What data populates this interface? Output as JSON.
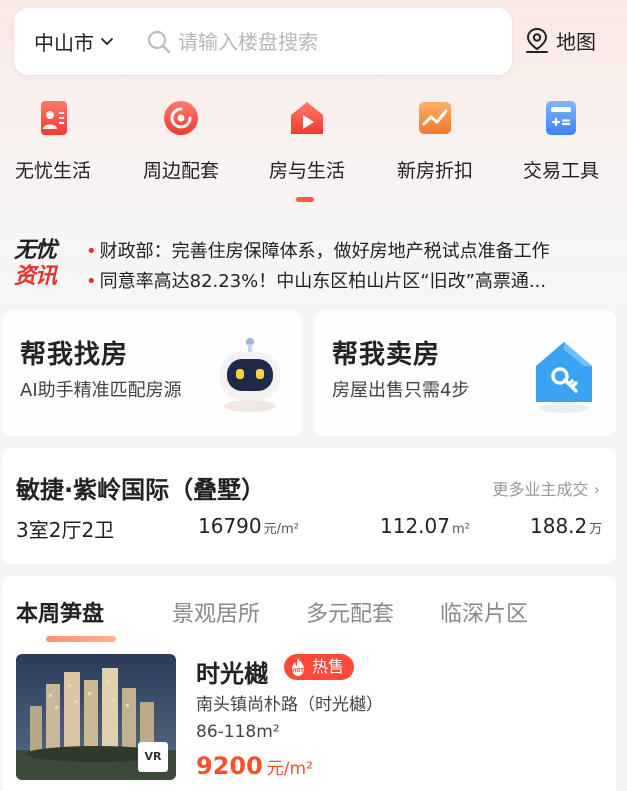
{
  "header": {
    "city": "中山市",
    "search_placeholder": "请输入楼盘搜索",
    "map_label": "地图"
  },
  "quick_nav": [
    {
      "label": "无忧生活",
      "icon": "resume-icon"
    },
    {
      "label": "周边配套",
      "icon": "target-icon"
    },
    {
      "label": "房与生活",
      "icon": "house-play-icon"
    },
    {
      "label": "新房折扣",
      "icon": "chart-trend-icon"
    },
    {
      "label": "交易工具",
      "icon": "calculator-icon"
    }
  ],
  "news": {
    "logo_line1": "无忧",
    "logo_line2": "资讯",
    "items": [
      "财政部：完善住房保障体系，做好房地产税试点准备工作",
      "同意率高达82.23%！中山东区柏山片区“旧改”高票通..."
    ]
  },
  "help_cards": {
    "find": {
      "title": "帮我找房",
      "subtitle": "AI助手精准匹配房源"
    },
    "sell": {
      "title": "帮我卖房",
      "subtitle": "房屋出售只需4步"
    }
  },
  "deal": {
    "name": "敏捷·紫岭国际（叠墅）",
    "more": "更多业主成交",
    "layout": "3室2厅2卫",
    "unit_price": "16790",
    "unit_price_unit": "元/m²",
    "area": "112.07",
    "area_unit": "m²",
    "total": "188.2",
    "total_unit": "万"
  },
  "listing": {
    "tabs": [
      "本周笋盘",
      "景观居所",
      "多元配套",
      "临深片区"
    ],
    "active_tab": 0,
    "property": {
      "name": "时光樾",
      "badge": "热售",
      "hot_icon_text": "HOT",
      "vr_label": "VR",
      "address": "南头镇尚朴路（时光樾）",
      "area": "86-118m²",
      "price": "9200",
      "price_unit": "元/m²"
    }
  },
  "colors": {
    "accent": "#f4512c",
    "indicator": "#ff5a3c",
    "hot": "#ff4a3a"
  }
}
